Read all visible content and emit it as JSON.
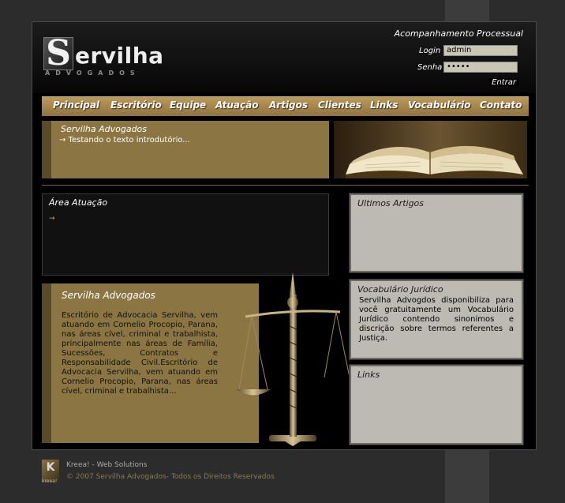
{
  "brand": {
    "logo_initial": "S",
    "logo_rest": "ervilha",
    "logo_sub": "ADVOGADOS"
  },
  "login": {
    "heading": "Acompanhamento Processual",
    "login_label": "Login",
    "login_value": "admin",
    "senha_label": "Senha",
    "senha_value": "•••••",
    "submit_label": "Entrar"
  },
  "nav": {
    "items": [
      "Principal",
      "Escritório",
      "Equipe",
      "Atuação",
      "Artigos",
      "Clientes",
      "Links",
      "Vocabulário",
      "Contato"
    ]
  },
  "intro": {
    "title": "Servilha Advogados",
    "text": "→ Testando o texto introdutório..."
  },
  "area": {
    "title": "Área Atuação",
    "arrow": "→"
  },
  "about": {
    "title": "Servilha Advogados",
    "text": "Escritório de Advocacia Servilha, vem atuando em Cornelio Procopio, Parana, nas áreas cível, criminal e trabalhista, principalmente nas áreas de Família, Sucessões, Contratos e Responsabilidade Civil.Escritório de Advocacia Servilha, vem atuando em Cornelio Procopio, Parana, nas áreas cível, criminal e trabalhista..."
  },
  "sidebar": {
    "articles_title": "Ultimos Artigos",
    "vocab_title": "Vocabulário Jurídico",
    "vocab_text": "Servilha Advogdos disponibiliza para você gratuitamente um Vocabulário Jurídico contendo sinonimos e discrição sobre termos referentes a Justiça.",
    "links_title": "Links"
  },
  "footer": {
    "logo_mark": "K",
    "logo_text": "kreea!",
    "credit": "Kreea! - Web Solutions",
    "copyright": "© 2007 Servilha Advogados- Todos os Direitos Reservados"
  }
}
